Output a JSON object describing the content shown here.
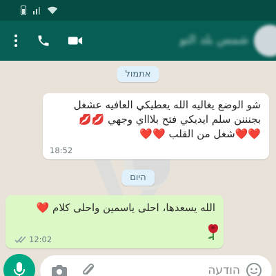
{
  "header": {
    "contact_name": "شمس بلد التو"
  },
  "messages": [
    {
      "date_label": "אתמול",
      "text": "شو الوضع يغاليه الله يعطيكي العافيه عشغل\nبجنننن سلم ايديكي  فتح بلاااي وجهي 💋💋\n❤️❤️شغل من القلب ❤️❤️",
      "time": "18:52",
      "direction": "incoming"
    },
    {
      "date_label": "היום",
      "text": "الله يسعدها، احلى ياسمين واحلى كلام ❤️",
      "time": "12:02",
      "direction": "outgoing",
      "status": "read",
      "attachment_icon": "rose-icon"
    }
  ],
  "input": {
    "placeholder": "הודעה"
  },
  "colors": {
    "header": "#075e54",
    "status_bar": "#054d44",
    "outgoing_bubble": "#dcf8c6",
    "incoming_bubble": "#ffffff",
    "accent": "#00a884",
    "heart": "#e0182d"
  }
}
